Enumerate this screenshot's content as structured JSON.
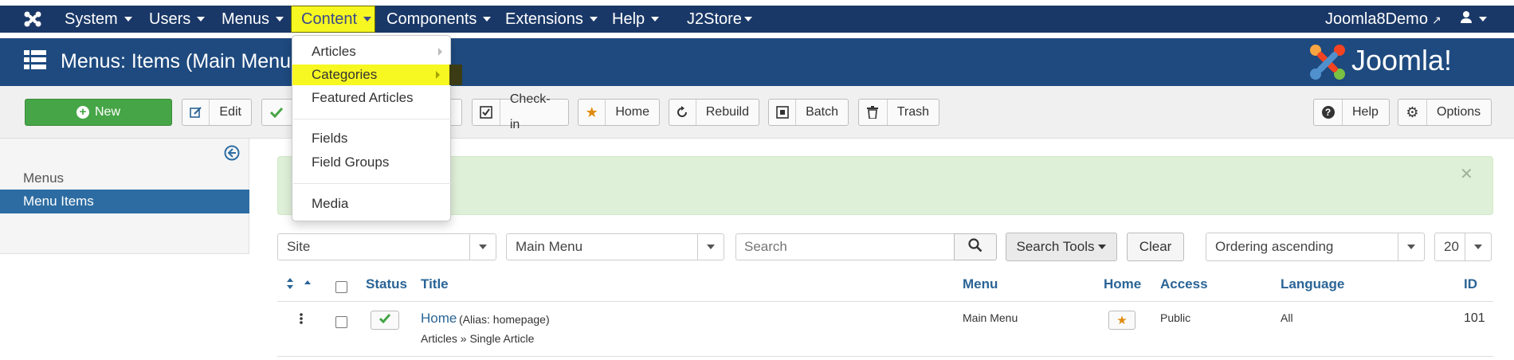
{
  "nav": {
    "items": [
      "System",
      "Users",
      "Menus",
      "Content",
      "Components",
      "Extensions",
      "Help",
      "J2Store"
    ],
    "site_link": "Joomla8Demo"
  },
  "header": {
    "title": "Menus: Items (Main Menu",
    "logo_text": "Joomla!"
  },
  "toolbar": {
    "new": "New",
    "edit": "Edit",
    "checkin": "Check-in",
    "home": "Home",
    "rebuild": "Rebuild",
    "batch": "Batch",
    "trash": "Trash",
    "help": "Help",
    "options": "Options"
  },
  "content_menu": {
    "items": [
      "Articles",
      "Categories",
      "Featured Articles",
      "Fields",
      "Field Groups",
      "Media"
    ],
    "highlighted": "Categories"
  },
  "sidebar": {
    "items": [
      "Menus",
      "Menu Items"
    ],
    "active": "Menu Items"
  },
  "filters": {
    "site": "Site",
    "menu": "Main Menu",
    "search_placeholder": "Search",
    "search_tools": "Search Tools",
    "clear": "Clear",
    "ordering": "Ordering ascending",
    "limit": "20"
  },
  "table": {
    "headers": [
      "Status",
      "Title",
      "Menu",
      "Home",
      "Access",
      "Language",
      "ID"
    ],
    "rows": [
      {
        "title": "Home",
        "alias": "(Alias: homepage)",
        "type": "Articles » Single Article",
        "menu": "Main Menu",
        "access": "Public",
        "language": "All",
        "id": "101"
      }
    ]
  },
  "colors": {
    "navbar": "#1a3867",
    "header": "#1e4a7f",
    "highlight": "#f7f721",
    "new_button": "#46a546",
    "sidebar_active": "#2d6ca2",
    "alert": "#dff0d8"
  }
}
